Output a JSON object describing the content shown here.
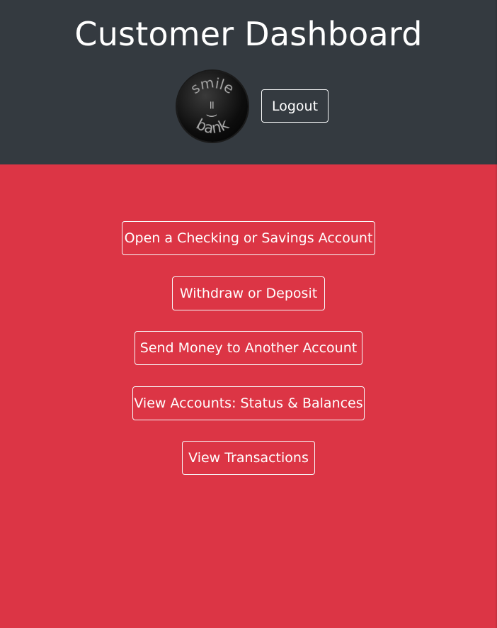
{
  "header": {
    "title": "Customer Dashboard",
    "logout_label": "Logout",
    "logo": {
      "top_text": "smile",
      "middle_text": "= )",
      "bottom_text": "bank"
    }
  },
  "menu": {
    "items": [
      {
        "label": "Open a Checking or Savings Account"
      },
      {
        "label": "Withdraw or Deposit"
      },
      {
        "label": "Send Money to Another Account"
      },
      {
        "label": "View Accounts: Status & Balances"
      },
      {
        "label": "View Transactions"
      }
    ]
  },
  "colors": {
    "header_bg": "#343a40",
    "page_bg": "#dc3545",
    "button_border": "#f8f9fa",
    "text": "#ffffff"
  }
}
